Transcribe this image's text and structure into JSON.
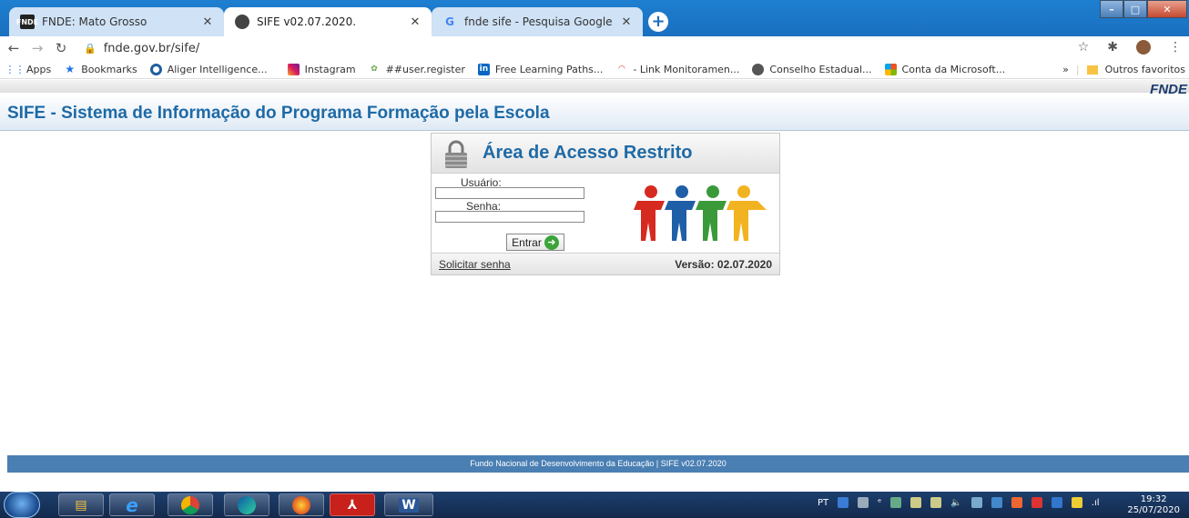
{
  "tabs": [
    {
      "title": "FNDE: Mato Grosso",
      "favicon": "FNDE",
      "active": false
    },
    {
      "title": "SIFE v02.07.2020.",
      "favicon": "chrome-icon",
      "active": true
    },
    {
      "title": "fnde sife - Pesquisa Google",
      "favicon": "G",
      "active": false
    }
  ],
  "newtab_label": "+",
  "address": {
    "url": "fnde.gov.br/sife/"
  },
  "bookmarks": [
    {
      "label": "Apps"
    },
    {
      "label": "Bookmarks"
    },
    {
      "label": "Aliger Intelligence..."
    },
    {
      "label": "Instagram"
    },
    {
      "label": "##user.register"
    },
    {
      "label": "Free Learning Paths..."
    },
    {
      "label": "- Link Monitoramen..."
    },
    {
      "label": "Conselho Estadual..."
    },
    {
      "label": "Conta da Microsoft..."
    }
  ],
  "bookmarks_more": "»",
  "bookmarks_other": "Outros favoritos",
  "brand": "FNDE",
  "site_title": "SIFE - Sistema de Informação do Programa Formação pela Escola",
  "login": {
    "title": "Área de Acesso Restrito",
    "user_label": "Usuário:",
    "pass_label": "Senha:",
    "submit_label": "Entrar",
    "request_link": "Solicitar senha",
    "version": "Versão: 02.07.2020"
  },
  "footer": "Fundo Nacional de Desenvolvimento da Educação | SIFE v02.07.2020",
  "taskbar": {
    "tray_lang": "PT",
    "time": "19:32",
    "date": "25/07/2020"
  }
}
